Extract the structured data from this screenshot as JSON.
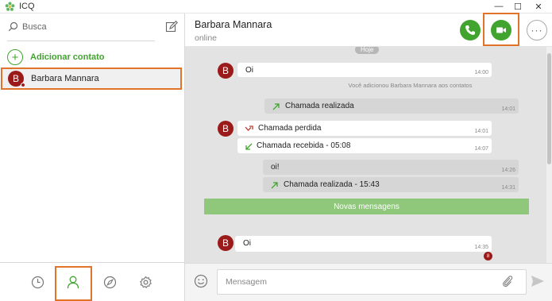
{
  "window": {
    "title": "ICQ",
    "minimize_glyph": "—",
    "maximize_glyph": "☐",
    "close_glyph": "✕"
  },
  "sidebar": {
    "search_placeholder": "Busca",
    "add_contact_label": "Adicionar contato",
    "add_contact_glyph": "+",
    "contacts": [
      {
        "initial": "B",
        "name": "Barbara Mannara",
        "selected": true
      }
    ],
    "bottom_nav": [
      "clock-icon",
      "contacts-icon",
      "compass-icon",
      "gear-icon"
    ]
  },
  "chat": {
    "contact_name": "Barbara Mannara",
    "status": "online",
    "more_glyph": "···",
    "date_divider": "Hoje",
    "system_note": "Você adicionou Barbara Mannara aos contatos",
    "new_messages_label": "Novas mensagens",
    "unread_count": "8",
    "messages": [
      {
        "avatar": "B",
        "text": "Oi",
        "time": "14:00"
      },
      {
        "text": "Chamada realizada",
        "time": "14:01"
      },
      {
        "avatar": "B",
        "text": "Chamada perdida",
        "time": "14:01"
      },
      {
        "text": "Chamada recebida - 05:08",
        "time": "14:07"
      },
      {
        "text": "oi!",
        "time": "14:26"
      },
      {
        "text": "Chamada realizada - 15:43",
        "time": "14:31"
      },
      {
        "avatar": "B",
        "text": "Oi",
        "time": "14:35"
      }
    ]
  },
  "composer": {
    "placeholder": "Mensagem"
  },
  "colors": {
    "accent_green": "#41a42f",
    "avatar_red": "#9b1b1b",
    "highlight_orange": "#e2732a",
    "new_messages_bar": "#8fc77b"
  }
}
